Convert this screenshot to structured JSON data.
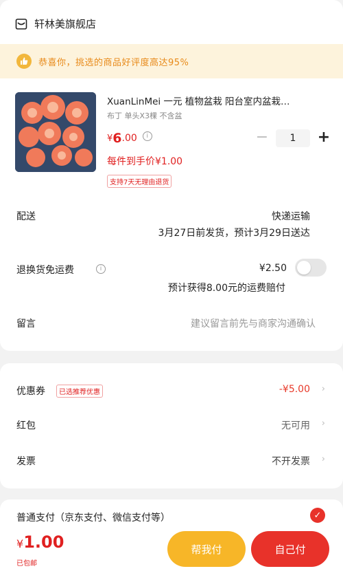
{
  "shop": {
    "name": "轩林美旗舰店",
    "icon": "shop-icon"
  },
  "banner": {
    "text": "恭喜你，挑选的商品好评度高达95%",
    "icon": "thumbs-up-icon"
  },
  "product": {
    "title": "XuanLinMei 一元 植物盆栽 阳台室内盆栽…",
    "spec": "布丁  单头X3棵  不含盆",
    "price_symbol": "¥",
    "price_int": "6",
    "price_dec": ".00",
    "unit_price": "每件到手价¥1.00",
    "return_tag": "支持7天无理由退货",
    "quantity": "1",
    "minus": "−",
    "plus": "+"
  },
  "delivery": {
    "label": "配送",
    "method": "快递运输",
    "schedule": "3月27日前发货，预计3月29日送达"
  },
  "return_shipping": {
    "label": "退换货免运费",
    "price": "¥2.50",
    "note": "预计获得8.00元的运费赔付",
    "toggle_on": false
  },
  "message": {
    "label": "留言",
    "placeholder": "建议留言前先与商家沟通确认"
  },
  "discounts": {
    "coupon_label": "优惠券",
    "coupon_tag": "已选推荐优惠",
    "coupon_value": "-¥5.00",
    "redpacket_label": "红包",
    "redpacket_value": "无可用",
    "invoice_label": "发票",
    "invoice_value": "不开发票",
    "chevron": "›"
  },
  "payment": {
    "label": "普通支付（京东支付、微信支付等）"
  },
  "footer": {
    "total_symbol": "¥",
    "total_value": "1.00",
    "free_shipping": "已包邮",
    "help_pay": "帮我付",
    "self_pay": "自己付"
  },
  "colors": {
    "accent_red": "#e02020",
    "accent_yellow": "#f7b628",
    "banner_bg": "#fdf3dc"
  }
}
